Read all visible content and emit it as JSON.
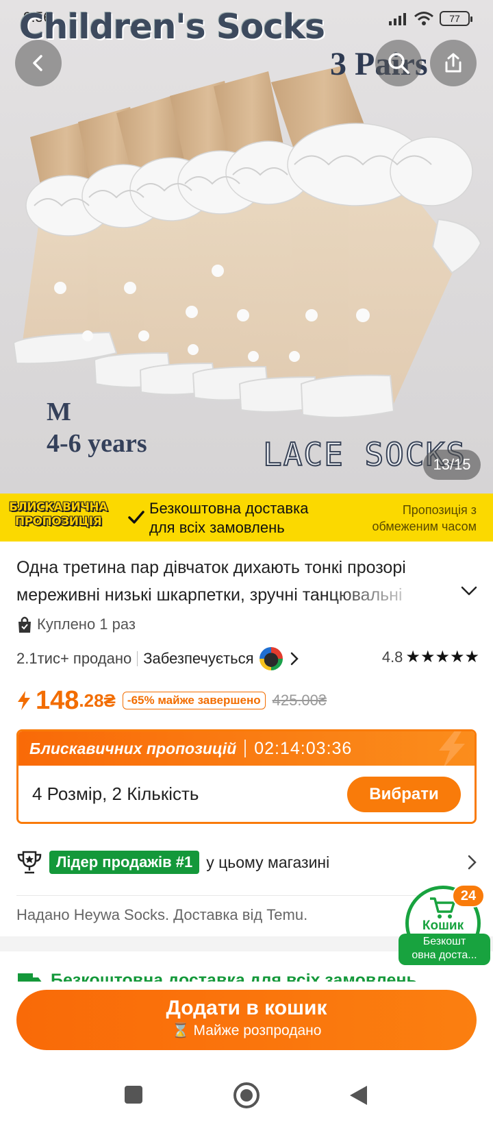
{
  "status_bar": {
    "time": "9:56",
    "battery": "77"
  },
  "hero": {
    "title_text": "Children's Socks",
    "pairs_text": "3  Pairs",
    "size_text": "M",
    "age_text": "4-6  years",
    "lace_text": "LACE SOCKS",
    "counter": "13/15"
  },
  "promo": {
    "badge_line1": "БЛИСКАВИЧНА",
    "badge_line2": "ПРОПОЗИЦІЯ",
    "free_line1": "Безкоштовна доставка",
    "free_line2": "для всіх замовлень",
    "limited_line1": "Пропозиція з",
    "limited_line2": "обмеженим часом"
  },
  "product": {
    "title": "Одна третина пар дівчаток дихають тонкі прозорі мереживні низькі шкарпетки, зручні танцювальні",
    "bought": "Куплено 1 раз",
    "sold": "2.1тис+ продано",
    "secured": "Забезпечується",
    "rating": "4.8",
    "stars": "★★★★★"
  },
  "price": {
    "main": "148",
    "cents": ".28₴",
    "discount": "-65% майже завершено",
    "old": "425.00₴"
  },
  "flash": {
    "title": "Блискавичних пропозицій",
    "timer": "02:14:03:36",
    "variant": "4 Розмір, 2 Кількість",
    "choose_label": "Вибрати"
  },
  "leader": {
    "badge": "Лідер продажів #1",
    "text": "у цьому магазині"
  },
  "seller": {
    "text": "Надано Heywa Socks. Доставка від Temu."
  },
  "shipping_peek": {
    "text": "Безкоштовна доставка для всіх замовлень"
  },
  "cart_float": {
    "count": "24",
    "label": "Кошик",
    "free_line1": "Безкошт",
    "free_line2": "овна доста..."
  },
  "cta": {
    "main": "Додати в кошик",
    "sub": "⌛ Майже розпродано"
  },
  "colors": {
    "accent": "#f97b0a",
    "green": "#18a33f",
    "promo_yellow": "#fbd900"
  }
}
